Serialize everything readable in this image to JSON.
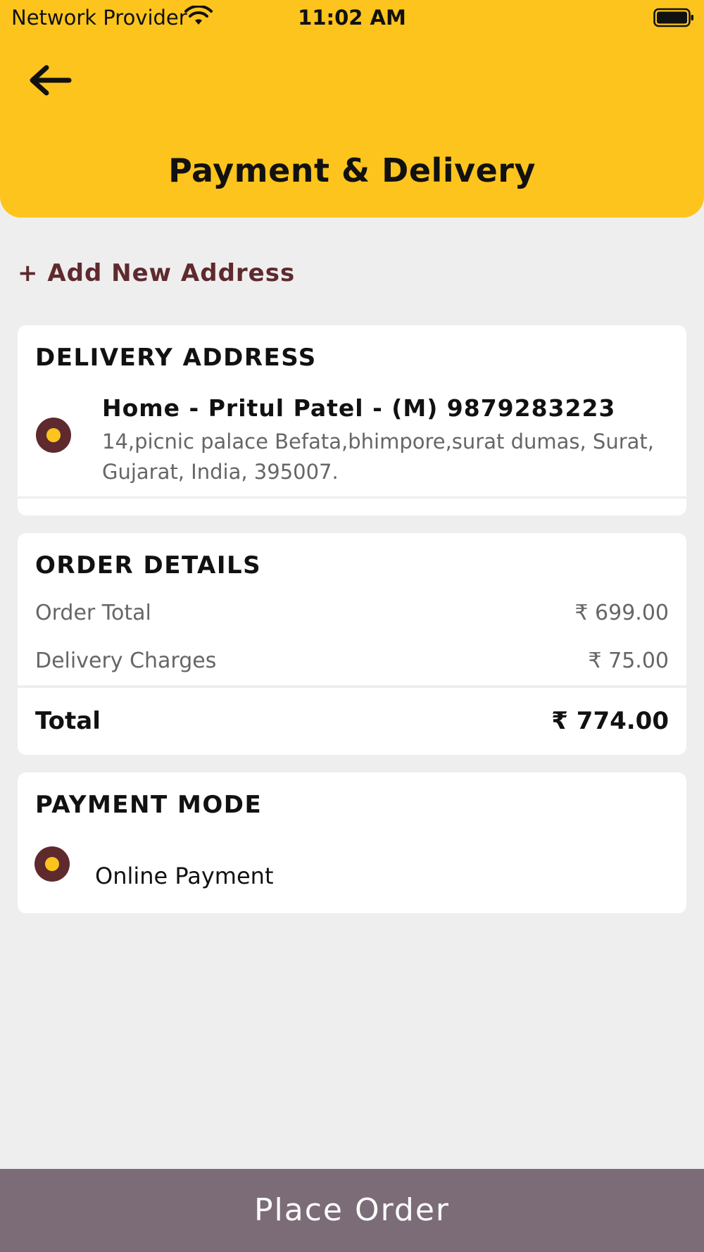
{
  "status_bar": {
    "carrier": "Network Provider",
    "time": "11:02 AM"
  },
  "header": {
    "title": "Payment & Delivery"
  },
  "add_address_label": "+ Add New Address",
  "delivery_address": {
    "title": "DELIVERY ADDRESS",
    "name_line": "Home - Pritul Patel - (M) 9879283223",
    "address_line1": "14,picnic palace  Befata,bhimpore,surat  dumas, Surat,",
    "address_line2": "Gujarat, India, 395007."
  },
  "order_details": {
    "title": "ORDER DETAILS",
    "rows": [
      {
        "label": "Order Total",
        "value": "₹ 699.00"
      },
      {
        "label": "Delivery Charges",
        "value": "₹ 75.00"
      }
    ],
    "total_label": "Total",
    "total_value": "₹ 774.00"
  },
  "payment_mode": {
    "title": "PAYMENT MODE",
    "option": "Online Payment"
  },
  "place_order_label": "Place Order",
  "colors": {
    "header": "#fdc41e",
    "accent": "#5e2a2e",
    "button": "#7b6c77",
    "background": "#efeeee"
  }
}
